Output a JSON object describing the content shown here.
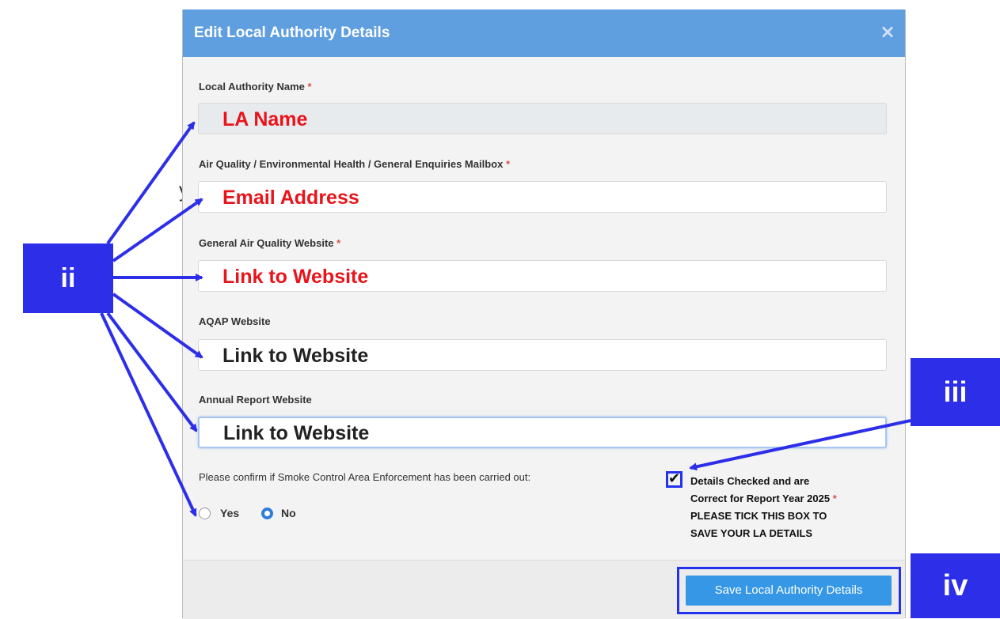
{
  "background_fragments": [
    "y",
    "."
  ],
  "modal": {
    "title": "Edit Local Authority Details",
    "close_symbol": "×"
  },
  "fields": [
    {
      "label": "Local Authority Name",
      "required": true,
      "value": "LA Name",
      "value_color": "#e8141b",
      "readonly": true
    },
    {
      "label": "Air Quality / Environmental Health / General Enquiries Mailbox",
      "required": true,
      "value": "Email Address",
      "value_color": "#e8141b"
    },
    {
      "label": "General Air Quality Website",
      "required": true,
      "value": "Link to Website",
      "value_color": "#e8141b"
    },
    {
      "label": "AQAP Website",
      "required": false,
      "value": "Link to Website",
      "value_color": "#222222"
    },
    {
      "label": "Annual Report Website",
      "required": false,
      "value": "Link to Website",
      "value_color": "#222222",
      "focused": true
    }
  ],
  "required_marker": "*",
  "smoke_control": {
    "question": "Please confirm if Smoke Control Area Enforcement has been carried out:",
    "options": [
      "Yes",
      "No"
    ],
    "selected": "No"
  },
  "confirm_checkbox": {
    "checked": true,
    "check_symbol": "✔",
    "line1": "Details Checked and are",
    "line2": "Correct for Report Year 2025",
    "line3": "PLEASE TICK THIS BOX TO",
    "line4": "SAVE YOUR LA DETAILS"
  },
  "save_button": {
    "label": "Save Local Authority Details",
    "color": "#3597e6"
  },
  "callouts": {
    "ii": "ii",
    "iii": "iii",
    "iv": "iv",
    "color": "#2d2ee8"
  },
  "colors": {
    "header": "#5f9fe0",
    "required": "#d9534f",
    "annotation": "#2d2ee8"
  }
}
